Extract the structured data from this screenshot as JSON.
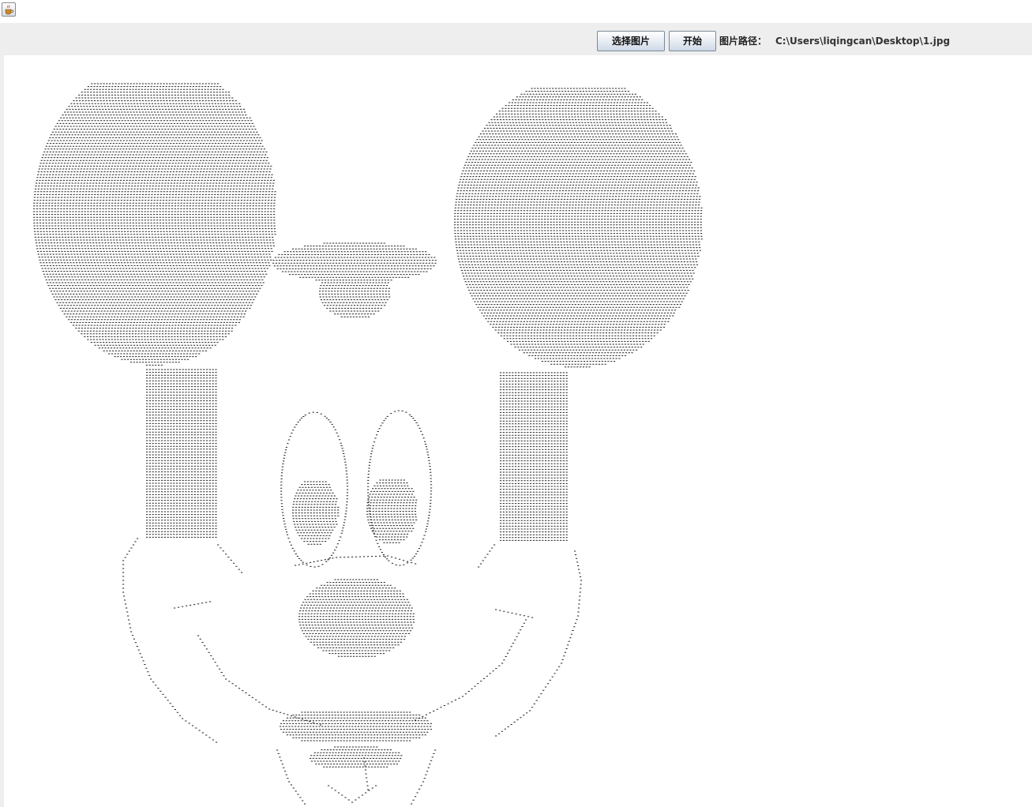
{
  "window": {
    "icon": "java-cup-icon"
  },
  "toolbar": {
    "choose_image_label": "选择图片",
    "start_label": "开始",
    "path_label": "图片路径：",
    "path_value": "C:\\Users\\liqingcan\\Desktop\\1.jpg"
  },
  "ascii_canvas": {
    "glyph": "-",
    "ink_color": "#222222",
    "background": "#ffffff"
  }
}
